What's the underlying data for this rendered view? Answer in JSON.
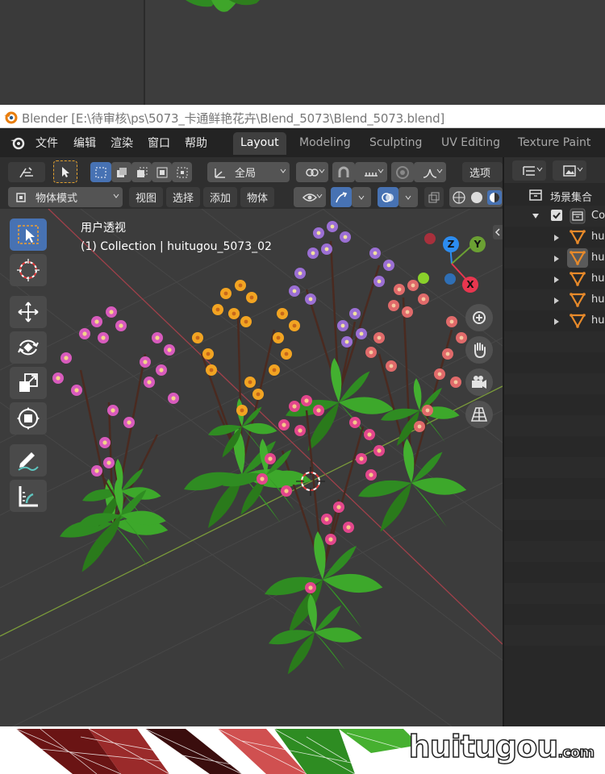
{
  "window": {
    "title": "Blender [E:\\待审核\\ps\\5073_卡通鲜艳花卉\\Blend_5073\\Blend_5073.blend]"
  },
  "menu": [
    "文件",
    "编辑",
    "渲染",
    "窗口",
    "帮助"
  ],
  "workspace_tabs": [
    {
      "label": "Layout",
      "active": true
    },
    {
      "label": "Modeling",
      "active": false
    },
    {
      "label": "Sculpting",
      "active": false
    },
    {
      "label": "UV Editing",
      "active": false
    },
    {
      "label": "Texture Paint",
      "active": false
    }
  ],
  "header": {
    "transform_orientation": "全局",
    "options_label": "选项",
    "mode_label": "物体模式",
    "view_menu": "视图",
    "select_menu": "选择",
    "add_menu": "添加",
    "object_menu": "物体"
  },
  "viewport": {
    "view_label": "用户透视",
    "collection_label": "(1) Collection | huitugou_5073_02"
  },
  "gizmo": {
    "x_label": "X",
    "y_label": "Y",
    "z_label": "Z",
    "x_color": "#e8364f",
    "y_color": "#6ba033",
    "z_color": "#2c8cf0"
  },
  "outliner": {
    "header_title": "场景集合",
    "collection_label": "Co",
    "items": [
      "hu",
      "hu",
      "hu",
      "hu",
      "hu"
    ]
  },
  "toolbar_tools": [
    "select-box-icon",
    "cursor-icon",
    "move-icon",
    "rotate-icon",
    "scale-icon",
    "transform-icon",
    "annotate-icon",
    "measure-icon"
  ],
  "nav_gizmos": [
    "zoom-icon",
    "pan-hand-icon",
    "camera-icon",
    "grid-perspective-icon"
  ],
  "watermark": {
    "text": "huitugou",
    "suffix": ".com"
  },
  "colors": {
    "accent": "#4772b3",
    "menubar": "#232323",
    "viewport_bg": "#3c3c3c"
  }
}
